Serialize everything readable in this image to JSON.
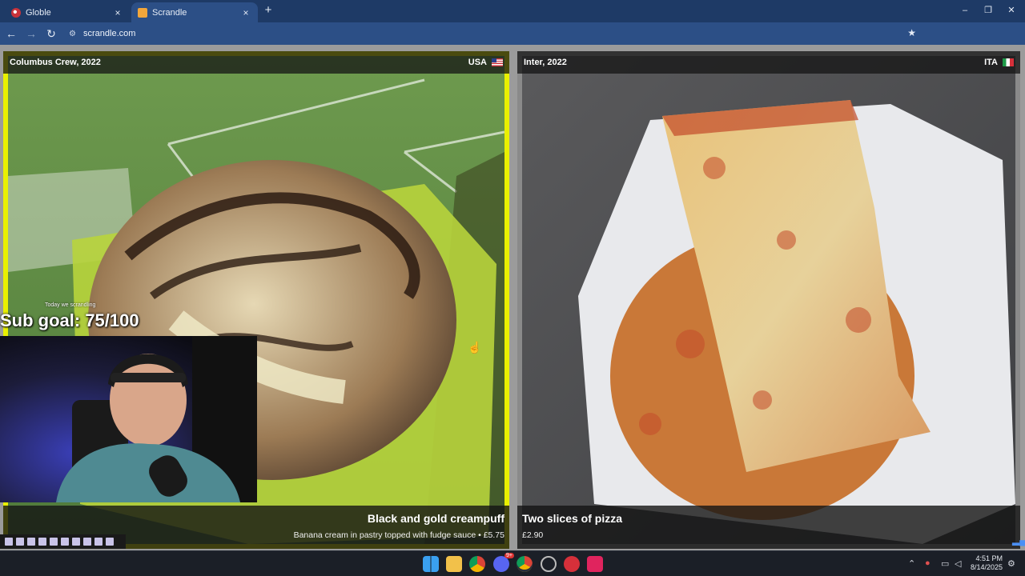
{
  "browser": {
    "tabs": [
      {
        "label": "Globle",
        "close": "×"
      },
      {
        "label": "Scrandle",
        "close": "×"
      }
    ],
    "new_tab": "+",
    "url": "scrandle.com",
    "window_controls": {
      "minimize": "–",
      "restore": "❐",
      "close": "✕"
    }
  },
  "cards": {
    "left": {
      "team": "Columbus Crew, 2022",
      "country": "USA",
      "title": "Black and gold creampuff",
      "subtitle": "Banana cream in pastry topped with fudge sauce • £5.75",
      "border_color": "#e9f000"
    },
    "right": {
      "team": "Inter, 2022",
      "country": "ITA",
      "title": "Two slices of pizza",
      "subtitle": "£2.90"
    }
  },
  "stream_overlay": {
    "sub_goal": "Sub goal: 75/100",
    "ticker": "Today we scrandling"
  },
  "taskbar": {
    "time": "4:51 PM",
    "date": "8/14/2025",
    "chrome_badge": "9+"
  }
}
